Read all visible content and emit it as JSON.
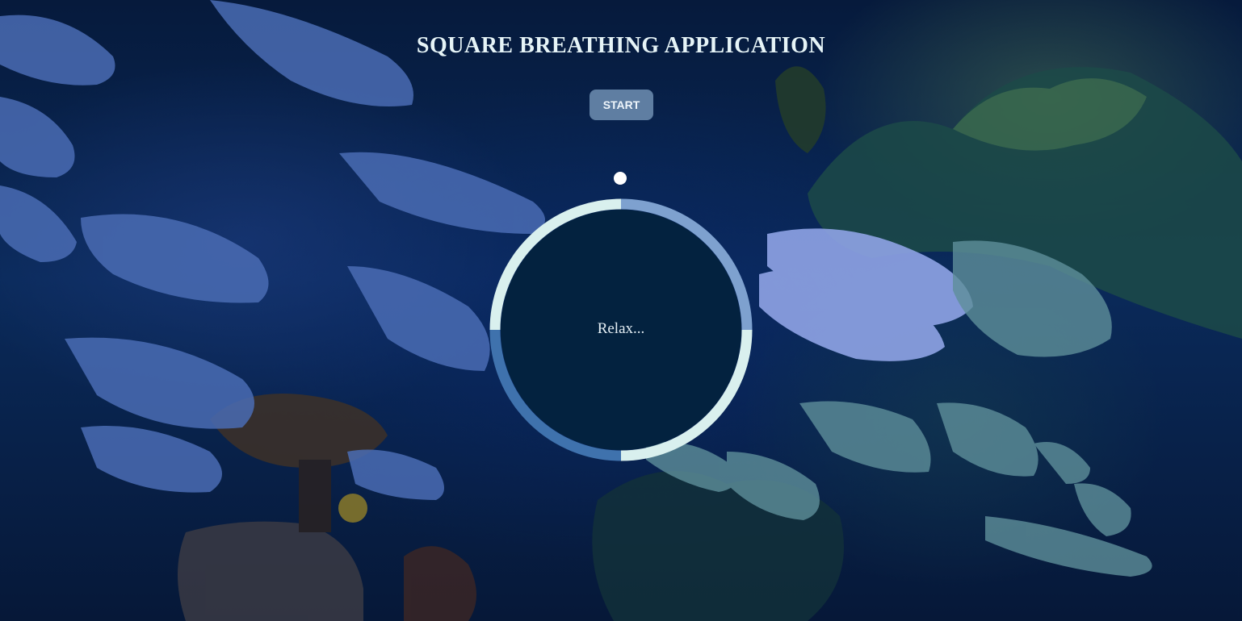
{
  "app": {
    "title": "SQUARE BREATHING APPLICATION"
  },
  "controls": {
    "start_label": "START"
  },
  "breathing_circle": {
    "status_text": "Relax...",
    "ring_colors": {
      "top_left": "#d9f0ee",
      "top_right": "#7ea1cf",
      "bottom_right": "#d9f0ee",
      "bottom_left": "#3f72ad"
    },
    "inner_color": "#03223f",
    "pointer_color": "#ffffff"
  },
  "background": {
    "icon": "underwater-fish-scene"
  }
}
